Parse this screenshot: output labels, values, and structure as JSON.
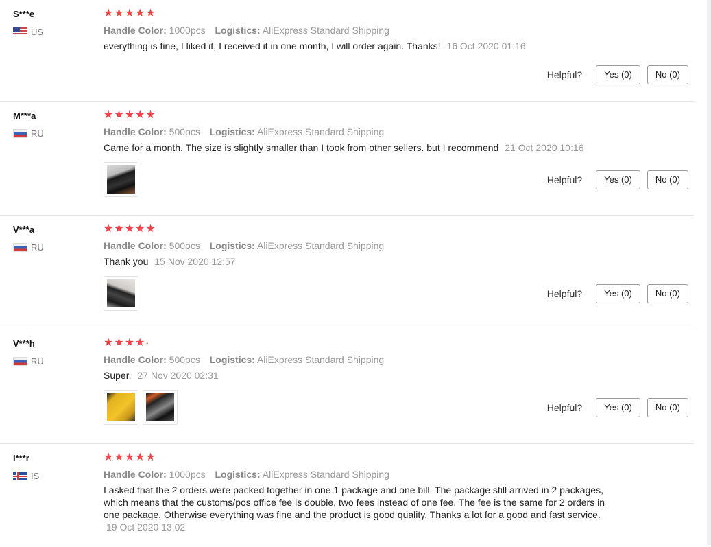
{
  "labels": {
    "handle_color": "Handle Color:",
    "logistics": "Logistics:",
    "helpful": "Helpful?",
    "yes": "Yes (0)",
    "no": "No (0)"
  },
  "reviews": [
    {
      "user": "S***e",
      "country": "US",
      "flag": "flag-us",
      "rating": 5,
      "handle_color": "1000pcs",
      "logistics": "AliExpress Standard Shipping",
      "text": "everything is fine, I liked it, I received it in one month, I will order again. Thanks!",
      "date": "16 Oct 2020 01:16"
    },
    {
      "user": "M***a",
      "country": "RU",
      "flag": "flag-ru",
      "rating": 5,
      "handle_color": "500pcs",
      "logistics": "AliExpress Standard Shipping",
      "text": "Came for a month. The size is slightly smaller than I took from other sellers. but I recommend",
      "date": "21 Oct 2020 10:16",
      "photos": [
        "review-photo-1"
      ]
    },
    {
      "user": "V***a",
      "country": "RU",
      "flag": "flag-ru",
      "rating": 5,
      "handle_color": "500pcs",
      "logistics": "AliExpress Standard Shipping",
      "text": "Thank you",
      "date": "15 Nov 2020 12:57",
      "photos": [
        "review-photo-1"
      ]
    },
    {
      "user": "V***h",
      "country": "RU",
      "flag": "flag-ru",
      "rating": 4.8,
      "handle_color": "500pcs",
      "logistics": "AliExpress Standard Shipping",
      "text": "Super.",
      "date": "27 Nov 2020 02:31",
      "photos": [
        "review-photo-1",
        "review-photo-2"
      ]
    },
    {
      "user": "I***r",
      "country": "IS",
      "flag": "flag-is",
      "rating": 5,
      "handle_color": "1000pcs",
      "logistics": "AliExpress Standard Shipping",
      "text": "I asked that the 2 orders were packed together in one 1 package and one bill. The package still arrived in 2 packages, which means that the customs/pos office fee is double, two fees instead of one fee. The fee is the same for 2 orders in one package. Otherwise everything was fine and the product is good quality. Thanks a lot for a good and fast service.",
      "date": "19 Oct 2020 13:02"
    }
  ],
  "colors": {
    "star": "#f0444a",
    "muted": "#999999",
    "border": "#e6e6e6"
  }
}
